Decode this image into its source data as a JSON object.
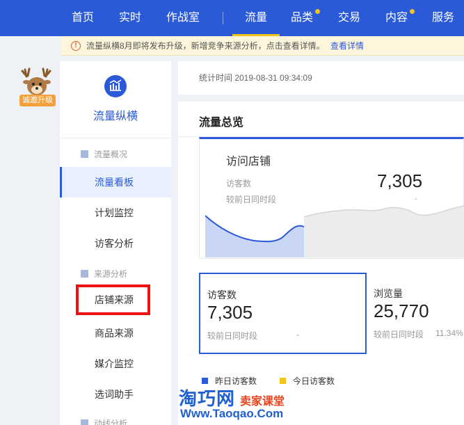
{
  "nav": {
    "items": [
      {
        "label": "首页"
      },
      {
        "label": "实时"
      },
      {
        "label": "作战室"
      },
      {
        "label": "流量"
      },
      {
        "label": "品类"
      },
      {
        "label": "交易"
      },
      {
        "label": "内容"
      },
      {
        "label": "服务"
      }
    ],
    "active": "流量",
    "accent": "#2a5ad7",
    "highlight": "#f5c418"
  },
  "notice": {
    "text": "流量纵横8月即将发布升级，新增竞争来源分析，点击查看详情。",
    "link": "查看详情"
  },
  "badge": {
    "label": "诚邀升级"
  },
  "sidebar": {
    "title": "流量纵横",
    "groups": [
      {
        "label": "流量概况"
      },
      {
        "label": "来源分析"
      },
      {
        "label": "动线分析"
      }
    ],
    "items": [
      {
        "label": "流量看板"
      },
      {
        "label": "计划监控"
      },
      {
        "label": "访客分析"
      },
      {
        "label": "店铺来源"
      },
      {
        "label": "商品来源"
      },
      {
        "label": "媒介监控"
      },
      {
        "label": "选词助手"
      }
    ],
    "active_item": "流量看板",
    "highlighted_item": "店铺来源"
  },
  "stat": {
    "text": "统计时间 2019-08-31 09:34:09"
  },
  "overview": {
    "title": "流量总览",
    "visit_card": {
      "title": "访问店铺",
      "label": "访客数",
      "sub": "较前日同时段",
      "value": "7,305",
      "dash": "-"
    },
    "metrics": [
      {
        "label": "访客数",
        "value": "7,305",
        "sub": "较前日同时段",
        "extra": "-"
      },
      {
        "label": "浏览量",
        "value": "25,770",
        "sub": "较前日同时段",
        "extra": "11.34%"
      }
    ],
    "legend": [
      {
        "label": "昨日访客数",
        "color": "#2a5ad7"
      },
      {
        "label": "今日访客数",
        "color": "#f5c418"
      }
    ]
  },
  "watermark": {
    "cn": "淘巧网",
    "red": "卖家课堂",
    "url": "Www.Taoqao.Com"
  }
}
